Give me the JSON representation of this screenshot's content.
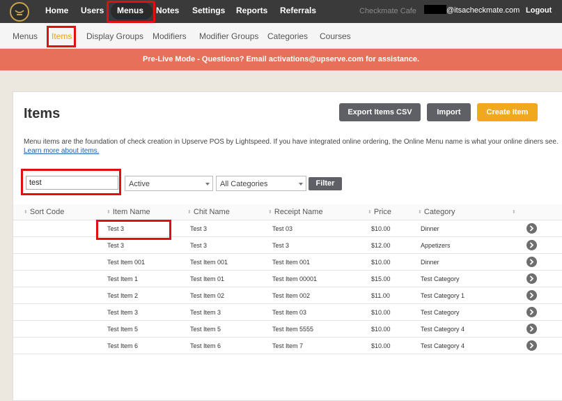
{
  "topnav": {
    "items": [
      "Home",
      "Users",
      "Menus",
      "Notes",
      "Settings",
      "Reports",
      "Referrals"
    ],
    "account_name": "Checkmate Cafe",
    "account_email": "@itsacheckmate.com",
    "logout": "Logout"
  },
  "subnav": {
    "items": [
      "Menus",
      "Items",
      "Display Groups",
      "Modifiers",
      "Modifier Groups",
      "Categories",
      "Courses"
    ],
    "active": "Items"
  },
  "banner": {
    "text": "Pre-Live Mode - Questions? Email activations@upserve.com for assistance."
  },
  "page": {
    "title": "Items",
    "buttons": {
      "export": "Export Items CSV",
      "import": "Import",
      "create": "Create Item"
    },
    "description": "Menu items are the foundation of check creation in Upserve POS by Lightspeed. If you have integrated online ordering, the Online Menu name is what your online diners see.",
    "learn_more": "Learn more about items."
  },
  "filters": {
    "search_value": "test",
    "status_selected": "Active",
    "category_selected": "All Categories",
    "filter_button": "Filter"
  },
  "table": {
    "columns": [
      "Sort Code",
      "Item Name",
      "Chit Name",
      "Receipt Name",
      "Price",
      "Category"
    ],
    "rows": [
      {
        "sort": "",
        "item": "Test 3",
        "chit": "Test 3",
        "receipt": "Test 03",
        "price": "$10.00",
        "category": "Dinner"
      },
      {
        "sort": "",
        "item": "Test 3",
        "chit": "Test 3",
        "receipt": "Test 3",
        "price": "$12.00",
        "category": "Appetizers"
      },
      {
        "sort": "",
        "item": "Test Item 001",
        "chit": "Test Item 001",
        "receipt": "Test Item 001",
        "price": "$10.00",
        "category": "Dinner"
      },
      {
        "sort": "",
        "item": "Test Item 1",
        "chit": "Test Item 01",
        "receipt": "Test Item 00001",
        "price": "$15.00",
        "category": "Test Category"
      },
      {
        "sort": "",
        "item": "Test Item 2",
        "chit": "Test Item 02",
        "receipt": "Test Item 002",
        "price": "$11.00",
        "category": "Test Category 1"
      },
      {
        "sort": "",
        "item": "Test Item 3",
        "chit": "Test Item 3",
        "receipt": "Test Item 03",
        "price": "$10.00",
        "category": "Test Category"
      },
      {
        "sort": "",
        "item": "Test Item 5",
        "chit": "Test Item 5",
        "receipt": "Test Item 5555",
        "price": "$10.00",
        "category": "Test Category 4"
      },
      {
        "sort": "",
        "item": "Test Item 6",
        "chit": "Test Item 6",
        "receipt": "Test Item 7",
        "price": "$10.00",
        "category": "Test Category 4"
      }
    ]
  },
  "colors": {
    "topnav_bg": "#3a3a3a",
    "banner_bg": "#e6705a",
    "accent_gold": "#f0a81c",
    "button_grey": "#5f5f66",
    "highlight_red": "#e01010"
  },
  "icons": {
    "logo": "upserve-logo-icon",
    "row_action": "chevron-right-icon",
    "sort": "sort-arrows-icon",
    "dropdown": "caret-down-icon"
  }
}
